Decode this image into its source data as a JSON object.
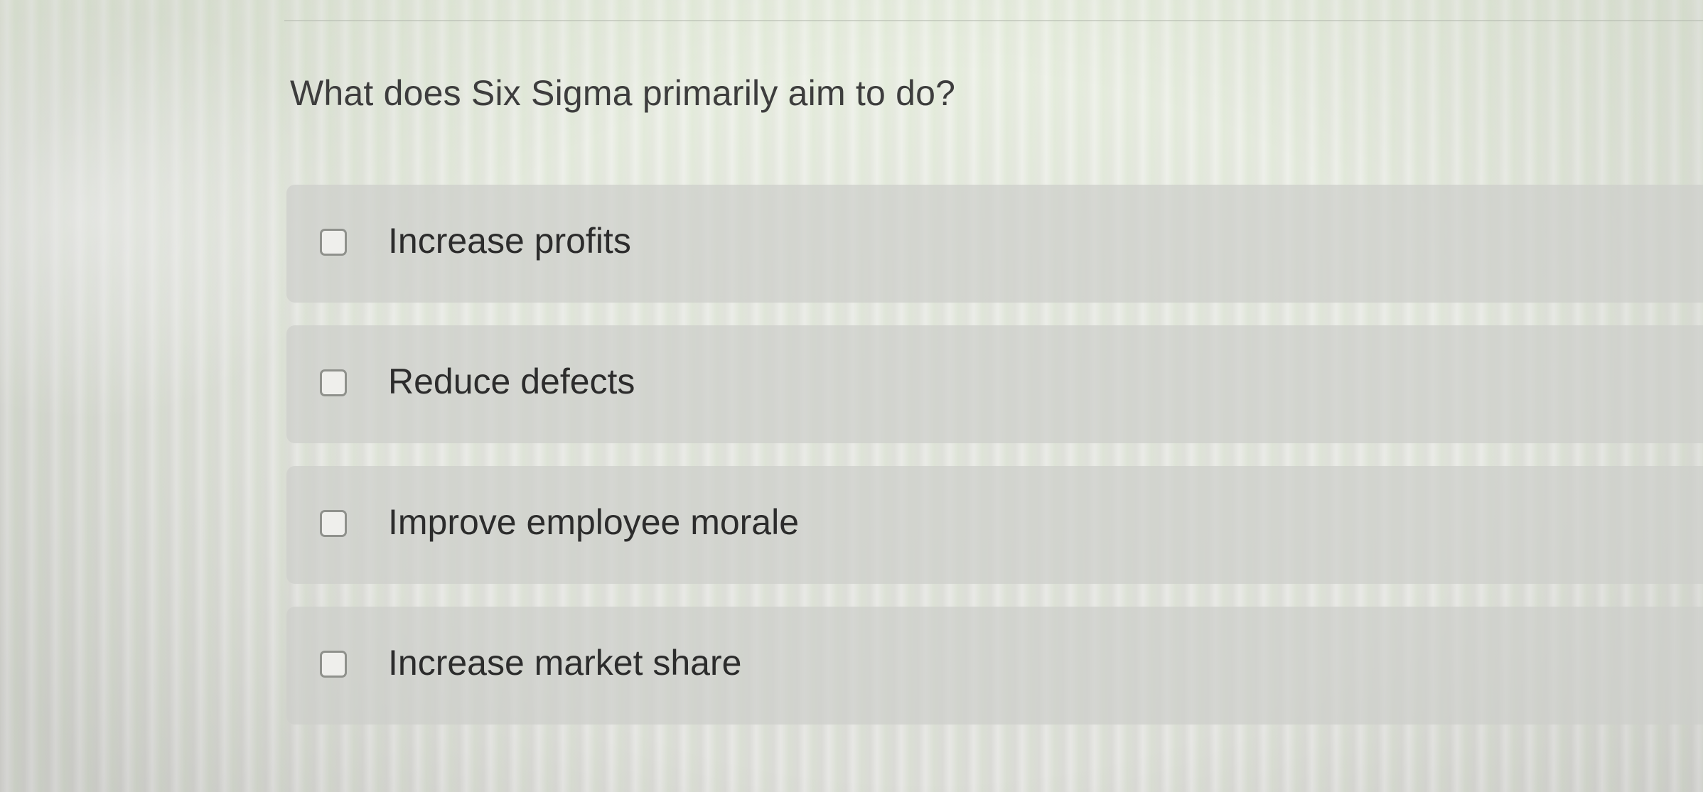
{
  "question": {
    "text": "What does Six Sigma primarily aim to do?"
  },
  "options": [
    {
      "label": "Increase profits",
      "checked": false
    },
    {
      "label": "Reduce defects",
      "checked": false
    },
    {
      "label": "Improve employee morale",
      "checked": false
    },
    {
      "label": "Increase market share",
      "checked": false
    }
  ],
  "colors": {
    "option_background": "#cdcfca",
    "checkbox_border": "#8f918c",
    "text": "#2c2c2c"
  }
}
